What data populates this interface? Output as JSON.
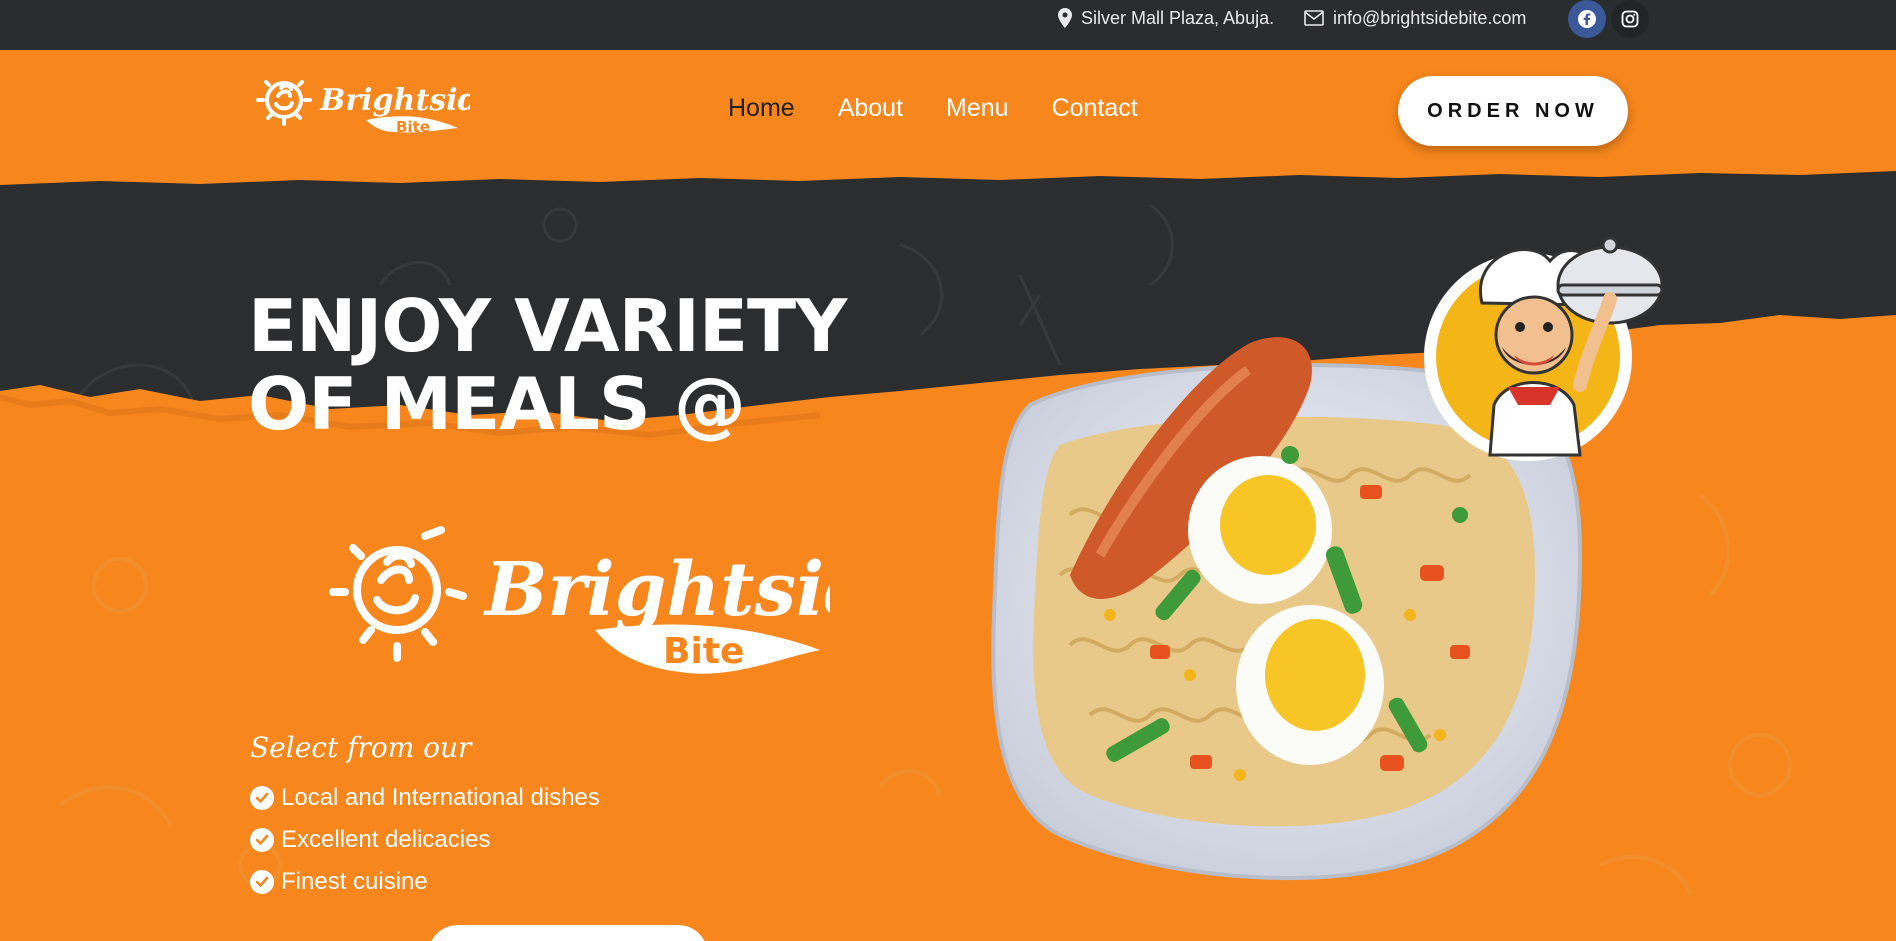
{
  "topbar": {
    "location": "Silver Mall Plaza, Abuja.",
    "email": "info@brightsidebite.com",
    "social": [
      {
        "name": "facebook",
        "icon": "facebook-icon",
        "glyph": "f"
      },
      {
        "name": "instagram",
        "icon": "instagram-icon",
        "glyph": "◎"
      }
    ]
  },
  "brand": {
    "name": "Brightside",
    "tagline": "Bite"
  },
  "nav": {
    "items": [
      {
        "label": "Home",
        "active": true
      },
      {
        "label": "About",
        "active": false
      },
      {
        "label": "Menu",
        "active": false
      },
      {
        "label": "Contact",
        "active": false
      }
    ],
    "cta": "ORDER NOW"
  },
  "hero": {
    "headline_line1": "ENJOY VARIETY",
    "headline_line2": "OF MEALS @",
    "select_title": "Select from our",
    "features": [
      "Local and International dishes",
      "Excellent delicacies",
      "Finest cuisine"
    ]
  },
  "colors": {
    "brand_orange": "#f7861c",
    "dark": "#2a2d2f",
    "white": "#ffffff"
  }
}
